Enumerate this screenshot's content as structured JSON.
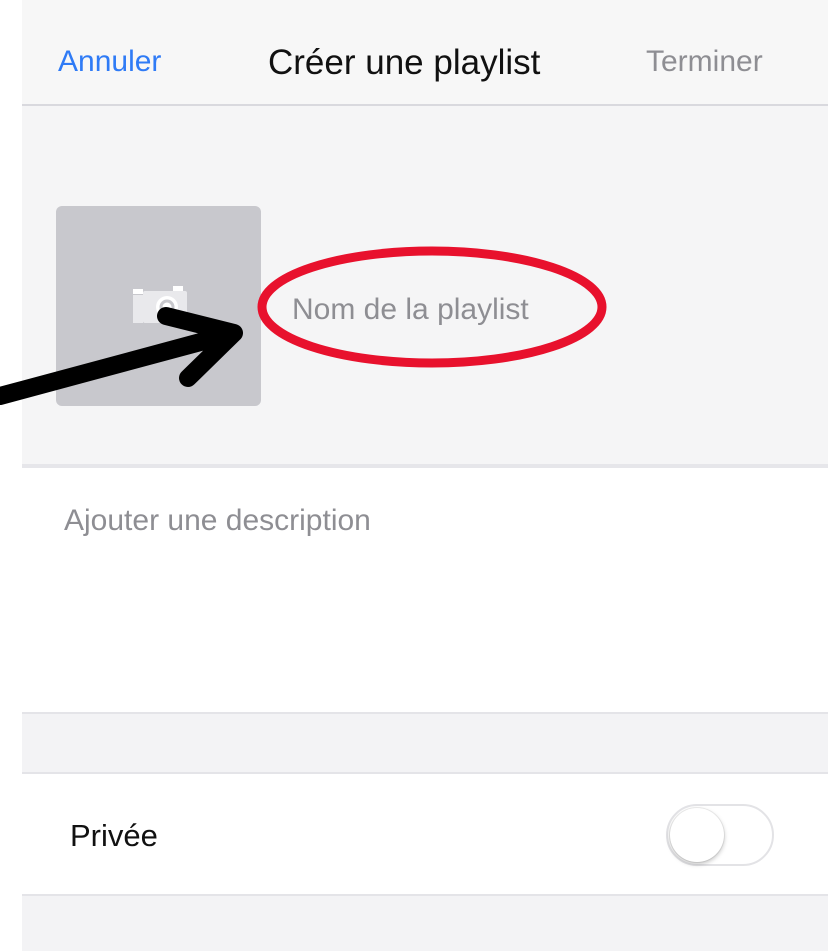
{
  "nav": {
    "cancel_label": "Annuler",
    "title": "Créer une playlist",
    "done_label": "Terminer"
  },
  "playlist": {
    "artwork_icon": "camera-icon",
    "name_placeholder": "Nom de la playlist",
    "name_value": "",
    "description_placeholder": "Ajouter une description",
    "description_value": ""
  },
  "privacy": {
    "label": "Privée",
    "enabled": false
  },
  "annotations": {
    "highlight_color": "#e8112d",
    "arrow_color": "#000000"
  },
  "colors": {
    "accent": "#2f7bf6",
    "disabled_text": "#8e8e93",
    "artwork_bg": "#c8c8cd"
  }
}
